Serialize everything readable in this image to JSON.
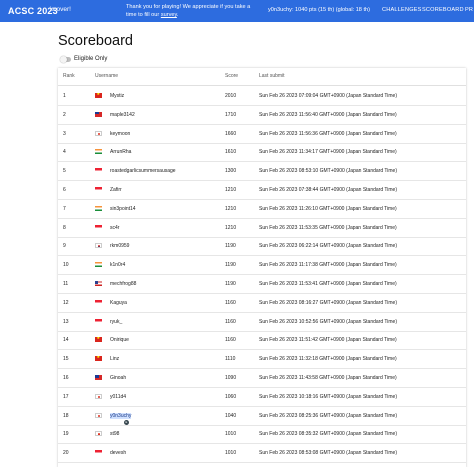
{
  "header": {
    "brand": "ACSC 2023",
    "over": "is over!",
    "message_lines": [
      "Thank you for playing! We appreciate if you take a",
      "time to fill our"
    ],
    "survey_link": "survey",
    "survey_suffix": ".",
    "user_status": "y0n3uchy: 1040 pts (15 th) (global: 18 th)",
    "nav": [
      "CHALLENGES",
      "SCOREBOARD",
      "PR"
    ],
    "bar_color": "#2d6cdf"
  },
  "page": {
    "title": "Scoreboard",
    "eligible_toggle_label": "Eligible Only"
  },
  "table": {
    "columns": [
      "Rank",
      "Username",
      "Score",
      "Last submit"
    ],
    "rows": [
      {
        "rank": "1",
        "flag": "vn",
        "username": "Mystiz",
        "score": "2010",
        "last": "Sun Feb 26 2023 07:09:04 GMT+0900 (Japan Standard Time)"
      },
      {
        "rank": "2",
        "flag": "tw",
        "username": "maple3142",
        "score": "1710",
        "last": "Sun Feb 26 2023 11:56:40 GMT+0900 (Japan Standard Time)"
      },
      {
        "rank": "3",
        "flag": "jp",
        "username": "keymoon",
        "score": "1660",
        "last": "Sun Feb 26 2023 11:56:36 GMT+0900 (Japan Standard Time)"
      },
      {
        "rank": "4",
        "flag": "in",
        "username": "ArrunRha",
        "score": "1610",
        "last": "Sun Feb 26 2023 11:34:17 GMT+0900 (Japan Standard Time)"
      },
      {
        "rank": "5",
        "flag": "sg",
        "username": "roastedgarlicsummersausage",
        "score": "1300",
        "last": "Sun Feb 26 2023 08:53:10 GMT+0900 (Japan Standard Time)"
      },
      {
        "rank": "6",
        "flag": "sg",
        "username": "Zafirr",
        "score": "1210",
        "last": "Sun Feb 26 2023 07:38:44 GMT+0900 (Japan Standard Time)"
      },
      {
        "rank": "7",
        "flag": "in",
        "username": "sin3point14",
        "score": "1210",
        "last": "Sun Feb 26 2023 11:26:10 GMT+0900 (Japan Standard Time)"
      },
      {
        "rank": "8",
        "flag": "sg",
        "username": "sc4r",
        "score": "1210",
        "last": "Sun Feb 26 2023 11:53:35 GMT+0900 (Japan Standard Time)"
      },
      {
        "rank": "9",
        "flag": "kr",
        "username": "rkm0959",
        "score": "1190",
        "last": "Sun Feb 26 2023 06:22:14 GMT+0900 (Japan Standard Time)"
      },
      {
        "rank": "10",
        "flag": "in",
        "username": "k1n0r4",
        "score": "1190",
        "last": "Sun Feb 26 2023 11:17:38 GMT+0900 (Japan Standard Time)"
      },
      {
        "rank": "11",
        "flag": "us",
        "username": "mechfrog88",
        "score": "1190",
        "last": "Sun Feb 26 2023 11:53:41 GMT+0900 (Japan Standard Time)"
      },
      {
        "rank": "12",
        "flag": "sg",
        "username": "Kaguya",
        "score": "1160",
        "last": "Sun Feb 26 2023 08:16:27 GMT+0900 (Japan Standard Time)"
      },
      {
        "rank": "13",
        "flag": "id",
        "username": "ryuk_",
        "score": "1160",
        "last": "Sun Feb 26 2023 10:52:56 GMT+0900 (Japan Standard Time)"
      },
      {
        "rank": "14",
        "flag": "vn",
        "username": "Onirique",
        "score": "1160",
        "last": "Sun Feb 26 2023 11:51:42 GMT+0900 (Japan Standard Time)"
      },
      {
        "rank": "15",
        "flag": "vn",
        "username": "Linz",
        "score": "1110",
        "last": "Sun Feb 26 2023 11:32:18 GMT+0900 (Japan Standard Time)"
      },
      {
        "rank": "16",
        "flag": "tw",
        "username": "Ginoah",
        "score": "1090",
        "last": "Sun Feb 26 2023 11:43:58 GMT+0900 (Japan Standard Time)"
      },
      {
        "rank": "17",
        "flag": "jp",
        "username": "y011d4",
        "score": "1060",
        "last": "Sun Feb 26 2023 10:18:16 GMT+0900 (Japan Standard Time)"
      },
      {
        "rank": "18",
        "flag": "jp",
        "username": "y0n3uchy",
        "score": "1040",
        "last": "Sun Feb 26 2023 08:25:36 GMT+0900 (Japan Standard Time)",
        "highlight": true
      },
      {
        "rank": "19",
        "flag": "jp",
        "username": "st98",
        "score": "1010",
        "last": "Sun Feb 26 2023 08:35:32 GMT+0900 (Japan Standard Time)"
      },
      {
        "rank": "20",
        "flag": "sg",
        "username": "devesh",
        "score": "1010",
        "last": "Sun Feb 26 2023 08:53:08 GMT+0900 (Japan Standard Time)"
      }
    ]
  }
}
